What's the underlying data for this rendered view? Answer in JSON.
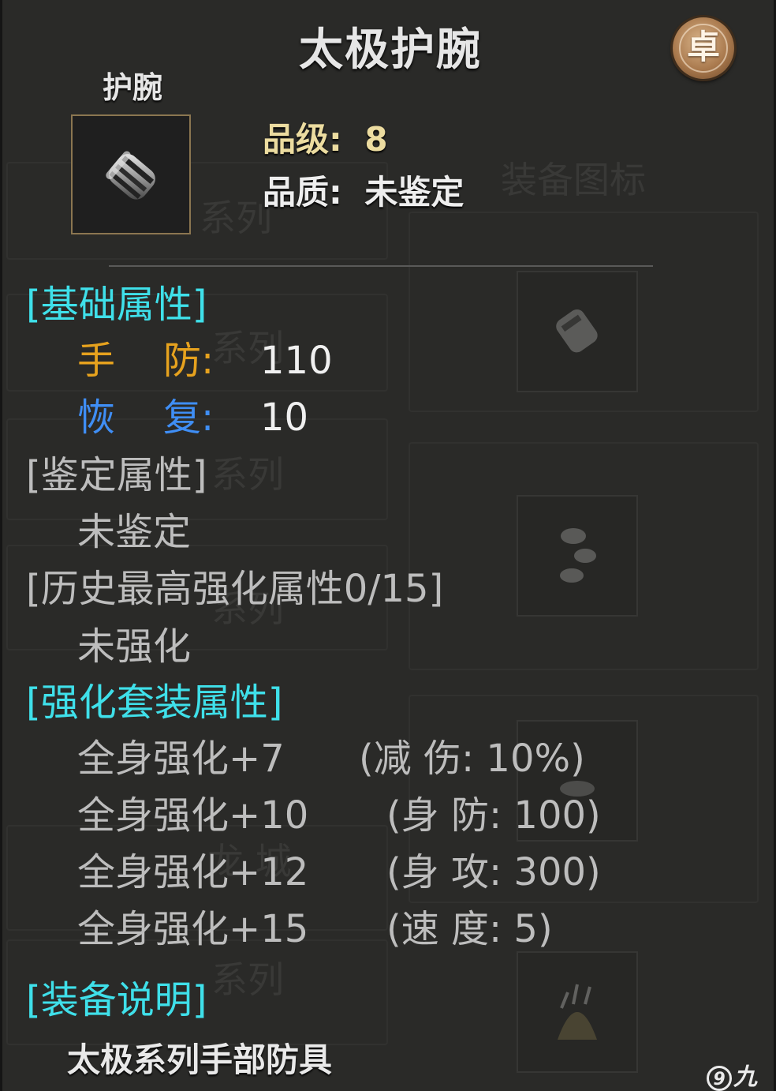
{
  "item": {
    "name": "太极护腕",
    "badge_char": "卓",
    "type": "护腕",
    "grade_label": "品级:",
    "grade_value": "8",
    "quality_label": "品质:",
    "quality_value": "未鉴定"
  },
  "background": {
    "title": "装备图标",
    "series": [
      "系列",
      "系列",
      "系列",
      "系列",
      "龙 城",
      "系列"
    ]
  },
  "base_attributes": {
    "header": "[基础属性]",
    "rows": [
      {
        "key": "手    防:",
        "value": "110",
        "color": "#e6a21e"
      },
      {
        "key": "恢    复:",
        "value": "10",
        "color": "#3f8ef5"
      }
    ]
  },
  "identify": {
    "header": "[鉴定属性]",
    "value": "未鉴定"
  },
  "history": {
    "header": "[历史最高强化属性0/15]",
    "value": "未强化"
  },
  "set_bonus": {
    "header": "[强化套装属性]",
    "rows": [
      {
        "level": "全身强化+7",
        "effect": "(减 伤: 10%)"
      },
      {
        "level": "全身强化+10",
        "effect": "(身 防: 100)"
      },
      {
        "level": "全身强化+12",
        "effect": "(身 攻: 300)"
      },
      {
        "level": "全身强化+15",
        "effect": "(速 度: 5)"
      }
    ]
  },
  "description": {
    "header": "[装备说明]",
    "text": "太极系列手部防具"
  },
  "watermark": {
    "symbol": "9",
    "text": "九游"
  },
  "colors": {
    "cyan_header": "#3fe0ea",
    "gold_meta": "#ecdca0",
    "gray_text": "#bdbdbd"
  },
  "icons": [
    "bracer-item-icon",
    "quality-badge-icon",
    "watermark-logo-icon"
  ]
}
